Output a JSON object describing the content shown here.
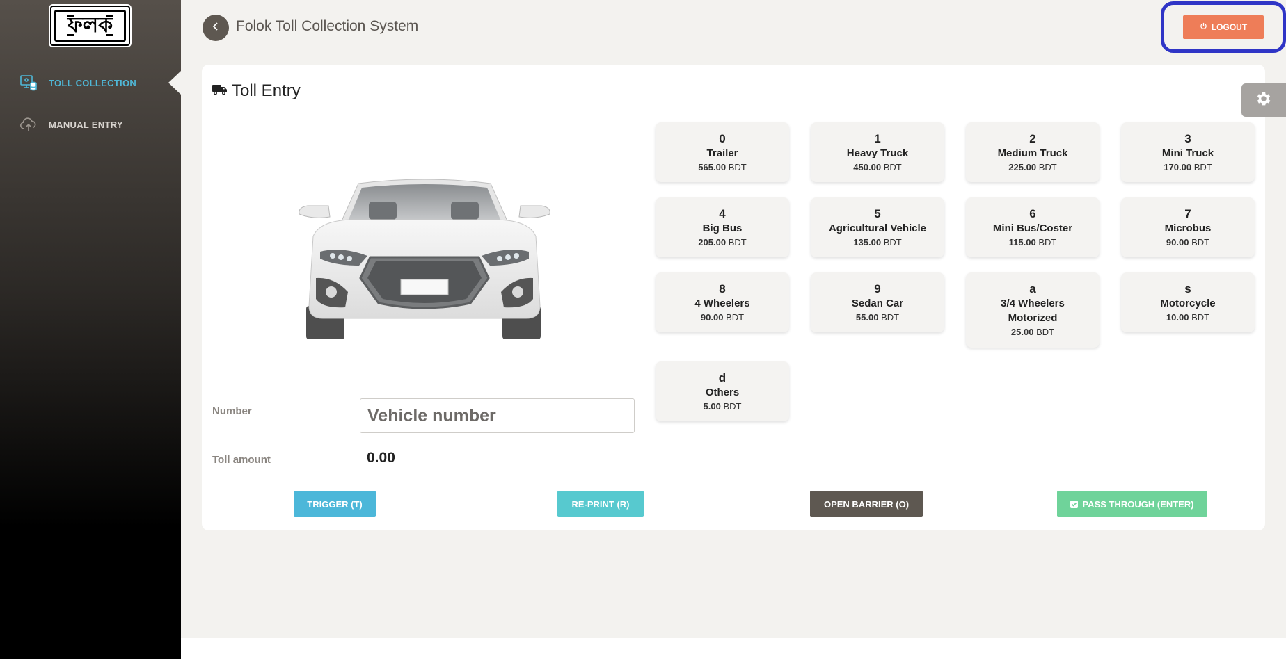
{
  "sidebar": {
    "logo_text": "ফলক",
    "items": [
      {
        "label": "TOLL COLLECTION",
        "icon": "toll-collection-icon"
      },
      {
        "label": "MANUAL ENTRY",
        "icon": "cloud-upload-icon"
      }
    ]
  },
  "header": {
    "title": "Folok Toll Collection System",
    "logout_label": "LOGOUT"
  },
  "main": {
    "card_title": "Toll Entry",
    "vehicles": [
      {
        "key": "0",
        "name": "Trailer",
        "price": "565.00",
        "currency": "BDT"
      },
      {
        "key": "1",
        "name": "Heavy Truck",
        "price": "450.00",
        "currency": "BDT"
      },
      {
        "key": "2",
        "name": "Medium Truck",
        "price": "225.00",
        "currency": "BDT"
      },
      {
        "key": "3",
        "name": "Mini Truck",
        "price": "170.00",
        "currency": "BDT"
      },
      {
        "key": "4",
        "name": "Big Bus",
        "price": "205.00",
        "currency": "BDT"
      },
      {
        "key": "5",
        "name": "Agricultural Vehicle",
        "price": "135.00",
        "currency": "BDT"
      },
      {
        "key": "6",
        "name": "Mini Bus/Coster",
        "price": "115.00",
        "currency": "BDT"
      },
      {
        "key": "7",
        "name": "Microbus",
        "price": "90.00",
        "currency": "BDT"
      },
      {
        "key": "8",
        "name": "4 Wheelers",
        "price": "90.00",
        "currency": "BDT"
      },
      {
        "key": "9",
        "name": "Sedan Car",
        "price": "55.00",
        "currency": "BDT"
      },
      {
        "key": "a",
        "name": "3/4 Wheelers Motorized",
        "price": "25.00",
        "currency": "BDT"
      },
      {
        "key": "s",
        "name": "Motorcycle",
        "price": "10.00",
        "currency": "BDT"
      },
      {
        "key": "d",
        "name": "Others",
        "price": "5.00",
        "currency": "BDT"
      }
    ],
    "form": {
      "number_label": "Number",
      "number_placeholder": "Vehicle number",
      "number_value": "",
      "toll_amount_label": "Toll amount",
      "toll_amount_value": "0.00"
    },
    "actions": {
      "trigger": "TRIGGER (T)",
      "reprint": "RE-PRINT (R)",
      "open_barrier": "OPEN BARRIER (O)",
      "pass_through": "PASS THROUGH (ENTER)"
    }
  },
  "colors": {
    "accent_blue": "#4fb8d8",
    "logout_orange": "#ee7d58",
    "highlight_ring": "#2f35c6",
    "trigger": "#4cb7d9",
    "reprint": "#57c9cf",
    "open_barrier": "#5e5851",
    "pass_through": "#6fd39a"
  }
}
